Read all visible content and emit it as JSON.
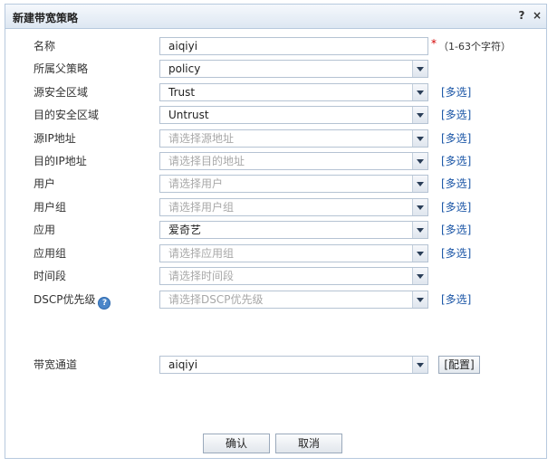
{
  "dialog": {
    "title": "新建带宽策略",
    "help": "?",
    "close": "×"
  },
  "form": {
    "name": {
      "label": "名称",
      "value": "aiqiyi",
      "required_mark": "*",
      "hint": "（1-63个字符）"
    },
    "parent_policy": {
      "label": "所属父策略",
      "value": "policy"
    },
    "src_zone": {
      "label": "源安全区域",
      "value": "Trust",
      "multi": "[多选]"
    },
    "dst_zone": {
      "label": "目的安全区域",
      "value": "Untrust",
      "multi": "[多选]"
    },
    "src_ip": {
      "label": "源IP地址",
      "placeholder": "请选择源地址",
      "multi": "[多选]"
    },
    "dst_ip": {
      "label": "目的IP地址",
      "placeholder": "请选择目的地址",
      "multi": "[多选]"
    },
    "user": {
      "label": "用户",
      "placeholder": "请选择用户",
      "multi": "[多选]"
    },
    "user_group": {
      "label": "用户组",
      "placeholder": "请选择用户组",
      "multi": "[多选]"
    },
    "application": {
      "label": "应用",
      "value": "爱奇艺",
      "multi": "[多选]"
    },
    "app_group": {
      "label": "应用组",
      "placeholder": "请选择应用组",
      "multi": "[多选]"
    },
    "time_range": {
      "label": "时间段",
      "placeholder": "请选择时间段"
    },
    "dscp": {
      "label": "DSCP优先级",
      "help": "?",
      "placeholder": "请选择DSCP优先级",
      "multi": "[多选]"
    },
    "channel": {
      "label": "带宽通道",
      "value": "aiqiyi",
      "config": "[配置]"
    }
  },
  "footer": {
    "ok": "确认",
    "cancel": "取消"
  },
  "colors": {
    "link": "#1a55a6",
    "required": "#d40000",
    "border": "#b7c9de"
  }
}
